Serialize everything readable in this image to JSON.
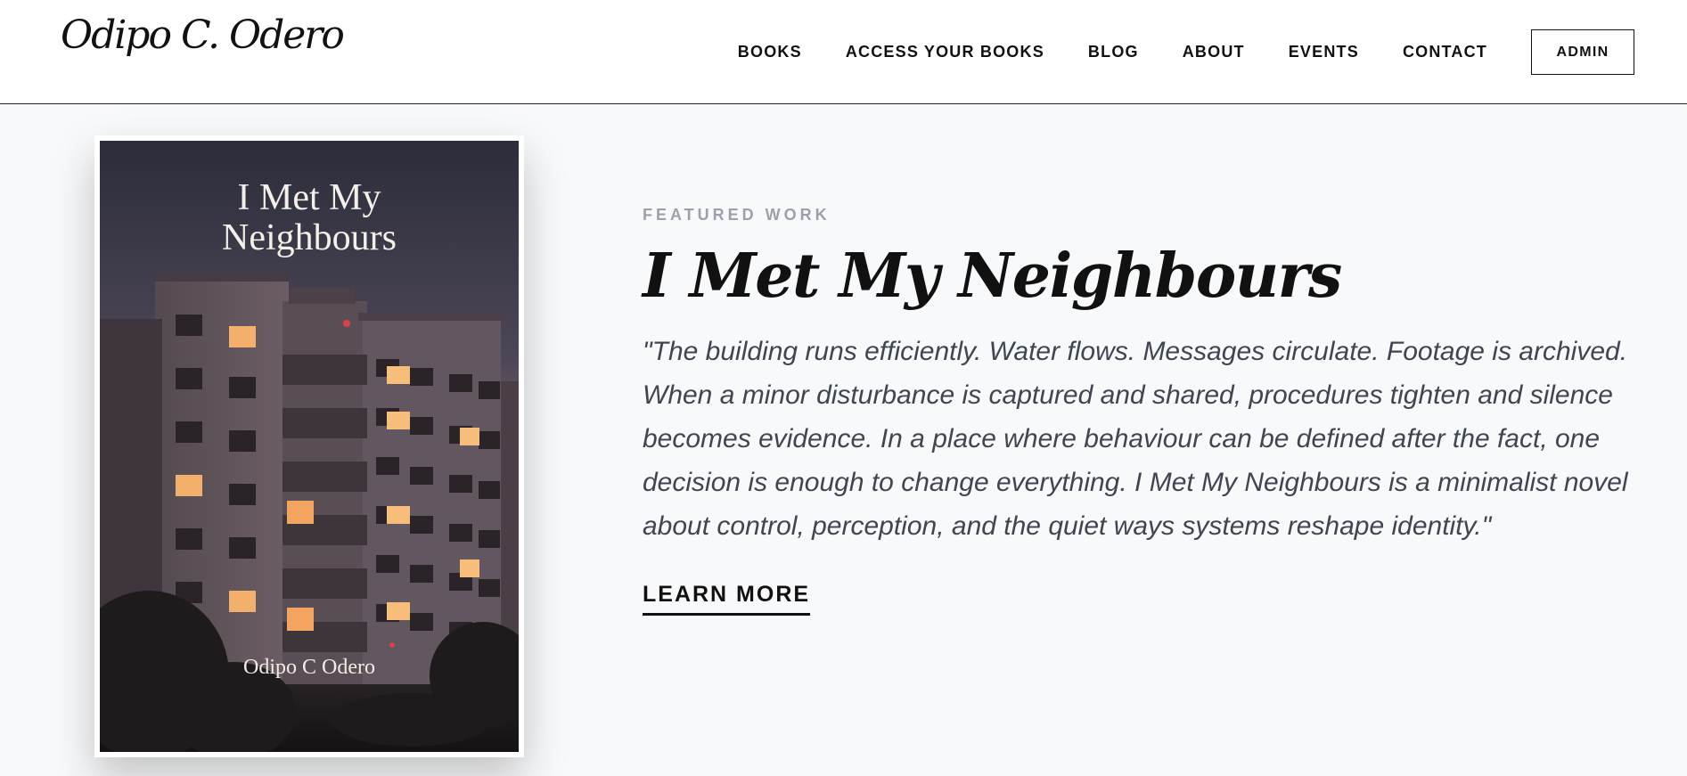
{
  "header": {
    "logo": "Odipo C. Odero",
    "nav": [
      "BOOKS",
      "ACCESS YOUR BOOKS",
      "BLOG",
      "ABOUT",
      "EVENTS",
      "CONTACT"
    ],
    "admin_label": "ADMIN"
  },
  "featured": {
    "eyebrow": "FEATURED WORK",
    "title": "I Met My Neighbours",
    "description": "\"The building runs efficiently. Water flows. Messages circulate. Footage is archived. When a minor disturbance is captured and shared, procedures tighten and silence becomes evidence. In a place where behaviour can be defined after the fact, one decision is enough to change everything. I Met My Neighbours is a minimalist novel about control, perception, and the quiet ways systems reshape identity.\"",
    "cta_label": "LEARN MORE",
    "cover": {
      "title_line1": "I Met My",
      "title_line2": "Neighbours",
      "author": "Odipo C Odero"
    }
  },
  "colors": {
    "page_background": "#f8f9fa",
    "eyebrow": "#9aa1ad",
    "body_text": "#3f4651",
    "ink": "#111111"
  }
}
